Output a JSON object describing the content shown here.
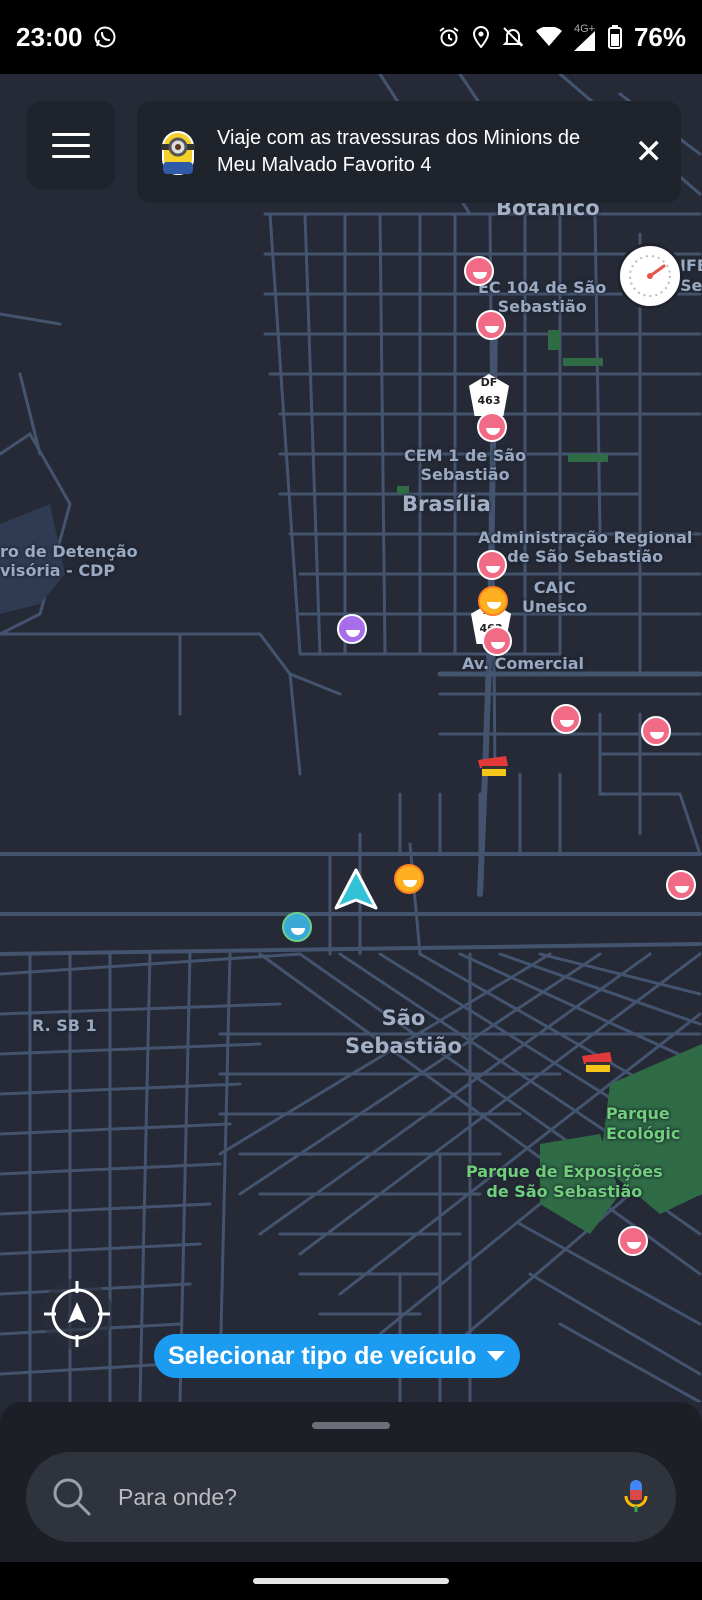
{
  "status_bar": {
    "time": "23:00",
    "network": "4G+",
    "battery": "76%",
    "icons": [
      "whatsapp-icon",
      "alarm-icon",
      "location-icon",
      "bell-off-icon",
      "wifi-icon",
      "signal-icon",
      "battery-icon"
    ]
  },
  "banner": {
    "text": "Viaje com as travessuras dos Minions de Meu Malvado Favorito 4"
  },
  "map": {
    "labels": {
      "botanico": "Botânico",
      "ec104": "EC 104 de São\nSebastião",
      "ifb": "IFB\nSeb",
      "cem1": "CEM 1 de São\nSebastião",
      "brasilia": "Brasília",
      "admin": "Administração Regional\nde São Sebastião",
      "cdp": "ro de Detenção\nvisória - CDP",
      "caic": "CAIC\nUnesco",
      "av_comercial": "Av. Comercial",
      "sao_sebastiao": "São\nSebastião",
      "rsb1": "R. SB 1",
      "parque_eco": "Parque\nEcológic",
      "parque_expo": "Parque de Exposições\nde São Sebastião"
    },
    "shield_label": "DF\n463"
  },
  "vehicle_button": {
    "label": "Selecionar tipo de veículo"
  },
  "search": {
    "placeholder": "Para onde?"
  },
  "colors": {
    "map_bg": "#252a36",
    "road": "#44546f",
    "accent_blue": "#1c9cf0",
    "park_green": "#2f6b45",
    "position_arrow": "#33c1d8"
  }
}
